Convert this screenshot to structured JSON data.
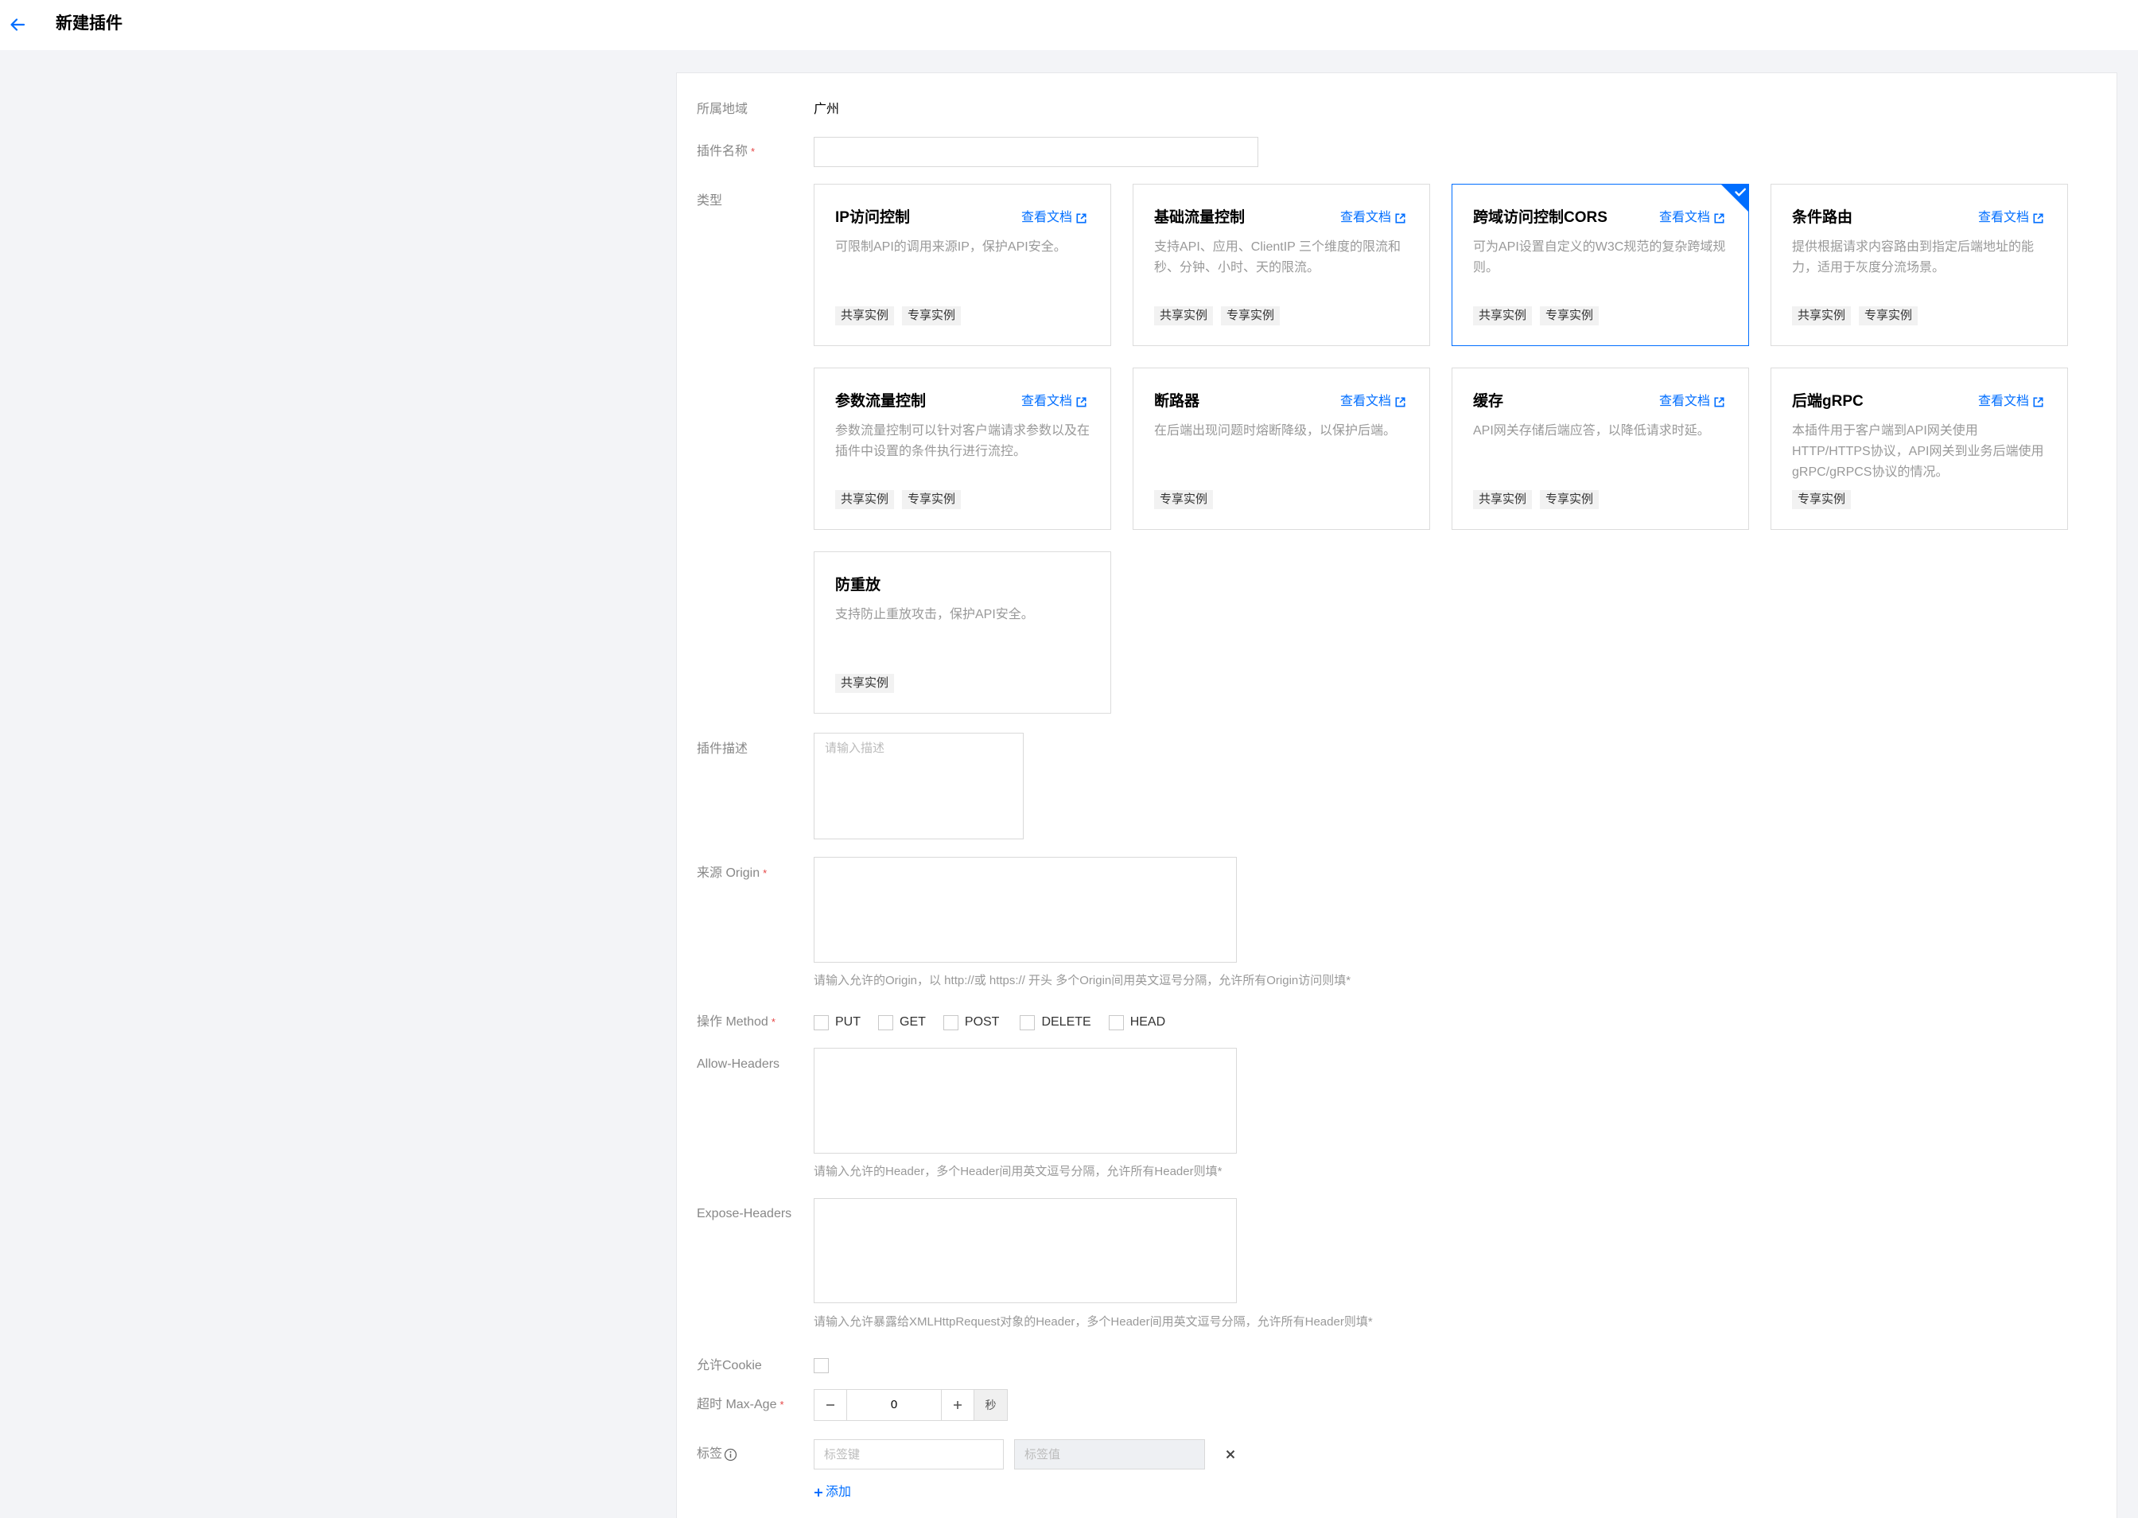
{
  "header": {
    "title": "新建插件",
    "back_icon": "arrow-left-icon"
  },
  "colors": {
    "accent": "#006eff",
    "required": "#e54545",
    "background": "#f3f4f7",
    "label": "#888888",
    "hint": "#999999",
    "border": "#d9d9d9",
    "tag_bg": "#f2f2f2"
  },
  "form": {
    "region": {
      "label": "所属地域",
      "value": "广州"
    },
    "name": {
      "label": "插件名称",
      "required_mark": "*"
    },
    "type": {
      "label": "类型",
      "doc_link_label": "查看文档",
      "doc_link_icon": "external-link-icon",
      "selected_icon": "check-icon",
      "cards": [
        {
          "title": "IP访问控制",
          "has_doc_link": true,
          "desc": "可限制API的调用来源IP，保护API安全。",
          "tags": [
            "共享实例",
            "专享实例"
          ],
          "selected": false
        },
        {
          "title": "基础流量控制",
          "has_doc_link": true,
          "desc": "支持API、应用、ClientIP 三个维度的限流和秒、分钟、小时、天的限流。",
          "tags": [
            "共享实例",
            "专享实例"
          ],
          "selected": false
        },
        {
          "title": "跨域访问控制CORS",
          "has_doc_link": true,
          "desc": "可为API设置自定义的W3C规范的复杂跨域规则。",
          "tags": [
            "共享实例",
            "专享实例"
          ],
          "selected": true
        },
        {
          "title": "条件路由",
          "has_doc_link": true,
          "desc": "提供根据请求内容路由到指定后端地址的能力，适用于灰度分流场景。",
          "tags": [
            "共享实例",
            "专享实例"
          ],
          "selected": false
        },
        {
          "title": "参数流量控制",
          "has_doc_link": true,
          "desc": "参数流量控制可以针对客户端请求参数以及在插件中设置的条件执行进行流控。",
          "tags": [
            "共享实例",
            "专享实例"
          ],
          "selected": false
        },
        {
          "title": "断路器",
          "has_doc_link": true,
          "desc": "在后端出现问题时熔断降级，以保护后端。",
          "tags": [
            "专享实例"
          ],
          "selected": false
        },
        {
          "title": "缓存",
          "has_doc_link": true,
          "desc": "API网关存储后端应答，以降低请求时延。",
          "tags": [
            "共享实例",
            "专享实例"
          ],
          "selected": false
        },
        {
          "title": "后端gRPC",
          "has_doc_link": true,
          "desc": "本插件用于客户端到API网关使用HTTP/HTTPS协议，API网关到业务后端使用gRPC/gRPCS协议的情况。",
          "tags": [
            "专享实例"
          ],
          "selected": false
        },
        {
          "title": "防重放",
          "has_doc_link": false,
          "desc": "支持防止重放攻击，保护API安全。",
          "tags": [
            "共享实例"
          ],
          "selected": false
        }
      ]
    },
    "description": {
      "label": "插件描述",
      "placeholder": "请输入描述"
    },
    "origin": {
      "label": "来源 Origin",
      "required_mark": "*",
      "hint": "请输入允许的Origin，以 http://或 https:// 开头 多个Origin间用英文逗号分隔，允许所有Origin访问则填*"
    },
    "method": {
      "label": "操作 Method",
      "required_mark": "*",
      "options": [
        {
          "label": "PUT",
          "checked": false
        },
        {
          "label": "GET",
          "checked": false
        },
        {
          "label": "POST",
          "checked": false
        },
        {
          "label": "DELETE",
          "checked": false
        },
        {
          "label": "HEAD",
          "checked": false
        }
      ]
    },
    "allow_headers": {
      "label": "Allow-Headers",
      "hint": "请输入允许的Header，多个Header间用英文逗号分隔，允许所有Header则填*"
    },
    "expose_headers": {
      "label": "Expose-Headers",
      "hint": "请输入允许暴露给XMLHttpRequest对象的Header，多个Header间用英文逗号分隔，允许所有Header则填*"
    },
    "allow_cookie": {
      "label": "允许Cookie",
      "checked": false
    },
    "max_age": {
      "label": "超时 Max-Age",
      "required_mark": "*",
      "value": 0,
      "unit": "秒",
      "minus_icon": "minus-icon",
      "plus_icon": "plus-icon"
    },
    "tags": {
      "label": "标签",
      "info_icon": "info-icon",
      "key_placeholder": "标签键",
      "value_placeholder": "标签值",
      "remove_icon": "close-icon",
      "add_label": "添加"
    }
  }
}
